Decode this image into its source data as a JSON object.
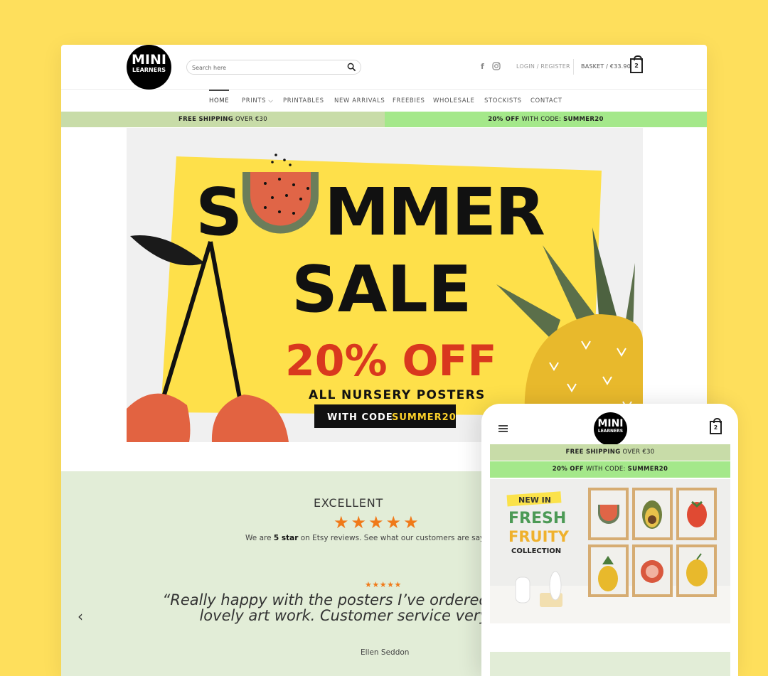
{
  "desktop": {
    "logo": {
      "line1": "MINI",
      "line2": "LEARNERS"
    },
    "search": {
      "placeholder": "Search here"
    },
    "header": {
      "login": "LOGIN / REGISTER",
      "basket": "BASKET / €33.90",
      "cart_count": "2"
    },
    "nav": [
      {
        "label": "HOME",
        "active": true
      },
      {
        "label": "PRINTS ⌵"
      },
      {
        "label": "PRINTABLES"
      },
      {
        "label": "NEW ARRIVALS"
      },
      {
        "label": "FREEBIES"
      },
      {
        "label": "WHOLESALE"
      },
      {
        "label": "STOCKISTS"
      },
      {
        "label": "CONTACT"
      }
    ],
    "promo_bars": {
      "shipping_bold": "FREE SHIPPING",
      "shipping_rest": " OVER €30",
      "discount_bold": "20% OFF",
      "discount_mid": " WITH CODE: ",
      "discount_code": "SUMMER20"
    },
    "hero": {
      "title1": "SUMMER",
      "title2": "SALE",
      "offer": "20% OFF",
      "subtitle": "ALL NURSERY POSTERS",
      "code_prefix": "WITH CODE ",
      "code": "SUMMER20"
    },
    "reviews": {
      "heading": "EXCELLENT",
      "stars": "★★★★★",
      "tagline_pre": "We are ",
      "tagline_bold": "5 star",
      "tagline_post": " on Etsy reviews. See what our customers are saying",
      "mini_stars": "★★★★★",
      "quote": "“Really happy with the posters I’ve ordered. Great product, lovely art work. Customer service very pleasant.”",
      "author": "Ellen Seddon",
      "prev": "‹"
    }
  },
  "mobile": {
    "logo": {
      "line1": "MINI",
      "line2": "LEARNERS"
    },
    "cart_count": "2",
    "bar1_bold": "FREE SHIPPING",
    "bar1_rest": " OVER €30",
    "bar2_bold": "20% OFF",
    "bar2_mid": " WITH CODE: ",
    "bar2_code": "SUMMER20",
    "banner": {
      "new_in": "NEW IN",
      "fresh": "FRESH",
      "fruity": "FRUITY",
      "collection": "COLLECTION"
    }
  },
  "colors": {
    "background": "#fedf5c",
    "star": "#f07a1a",
    "offer_red": "#d9381e",
    "bar_green_light": "#c8dca8",
    "bar_green_bright": "#a4e88a",
    "review_bg": "#e2edd7"
  }
}
